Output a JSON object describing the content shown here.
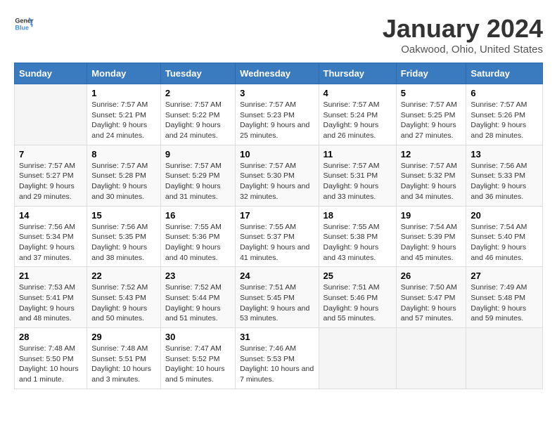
{
  "logo": {
    "line1": "General",
    "line2": "Blue"
  },
  "title": "January 2024",
  "subtitle": "Oakwood, Ohio, United States",
  "days_header": [
    "Sunday",
    "Monday",
    "Tuesday",
    "Wednesday",
    "Thursday",
    "Friday",
    "Saturday"
  ],
  "weeks": [
    [
      {
        "day": "",
        "sunrise": "",
        "sunset": "",
        "daylight": ""
      },
      {
        "day": "1",
        "sunrise": "Sunrise: 7:57 AM",
        "sunset": "Sunset: 5:21 PM",
        "daylight": "Daylight: 9 hours and 24 minutes."
      },
      {
        "day": "2",
        "sunrise": "Sunrise: 7:57 AM",
        "sunset": "Sunset: 5:22 PM",
        "daylight": "Daylight: 9 hours and 24 minutes."
      },
      {
        "day": "3",
        "sunrise": "Sunrise: 7:57 AM",
        "sunset": "Sunset: 5:23 PM",
        "daylight": "Daylight: 9 hours and 25 minutes."
      },
      {
        "day": "4",
        "sunrise": "Sunrise: 7:57 AM",
        "sunset": "Sunset: 5:24 PM",
        "daylight": "Daylight: 9 hours and 26 minutes."
      },
      {
        "day": "5",
        "sunrise": "Sunrise: 7:57 AM",
        "sunset": "Sunset: 5:25 PM",
        "daylight": "Daylight: 9 hours and 27 minutes."
      },
      {
        "day": "6",
        "sunrise": "Sunrise: 7:57 AM",
        "sunset": "Sunset: 5:26 PM",
        "daylight": "Daylight: 9 hours and 28 minutes."
      }
    ],
    [
      {
        "day": "7",
        "sunrise": "Sunrise: 7:57 AM",
        "sunset": "Sunset: 5:27 PM",
        "daylight": "Daylight: 9 hours and 29 minutes."
      },
      {
        "day": "8",
        "sunrise": "Sunrise: 7:57 AM",
        "sunset": "Sunset: 5:28 PM",
        "daylight": "Daylight: 9 hours and 30 minutes."
      },
      {
        "day": "9",
        "sunrise": "Sunrise: 7:57 AM",
        "sunset": "Sunset: 5:29 PM",
        "daylight": "Daylight: 9 hours and 31 minutes."
      },
      {
        "day": "10",
        "sunrise": "Sunrise: 7:57 AM",
        "sunset": "Sunset: 5:30 PM",
        "daylight": "Daylight: 9 hours and 32 minutes."
      },
      {
        "day": "11",
        "sunrise": "Sunrise: 7:57 AM",
        "sunset": "Sunset: 5:31 PM",
        "daylight": "Daylight: 9 hours and 33 minutes."
      },
      {
        "day": "12",
        "sunrise": "Sunrise: 7:57 AM",
        "sunset": "Sunset: 5:32 PM",
        "daylight": "Daylight: 9 hours and 34 minutes."
      },
      {
        "day": "13",
        "sunrise": "Sunrise: 7:56 AM",
        "sunset": "Sunset: 5:33 PM",
        "daylight": "Daylight: 9 hours and 36 minutes."
      }
    ],
    [
      {
        "day": "14",
        "sunrise": "Sunrise: 7:56 AM",
        "sunset": "Sunset: 5:34 PM",
        "daylight": "Daylight: 9 hours and 37 minutes."
      },
      {
        "day": "15",
        "sunrise": "Sunrise: 7:56 AM",
        "sunset": "Sunset: 5:35 PM",
        "daylight": "Daylight: 9 hours and 38 minutes."
      },
      {
        "day": "16",
        "sunrise": "Sunrise: 7:55 AM",
        "sunset": "Sunset: 5:36 PM",
        "daylight": "Daylight: 9 hours and 40 minutes."
      },
      {
        "day": "17",
        "sunrise": "Sunrise: 7:55 AM",
        "sunset": "Sunset: 5:37 PM",
        "daylight": "Daylight: 9 hours and 41 minutes."
      },
      {
        "day": "18",
        "sunrise": "Sunrise: 7:55 AM",
        "sunset": "Sunset: 5:38 PM",
        "daylight": "Daylight: 9 hours and 43 minutes."
      },
      {
        "day": "19",
        "sunrise": "Sunrise: 7:54 AM",
        "sunset": "Sunset: 5:39 PM",
        "daylight": "Daylight: 9 hours and 45 minutes."
      },
      {
        "day": "20",
        "sunrise": "Sunrise: 7:54 AM",
        "sunset": "Sunset: 5:40 PM",
        "daylight": "Daylight: 9 hours and 46 minutes."
      }
    ],
    [
      {
        "day": "21",
        "sunrise": "Sunrise: 7:53 AM",
        "sunset": "Sunset: 5:41 PM",
        "daylight": "Daylight: 9 hours and 48 minutes."
      },
      {
        "day": "22",
        "sunrise": "Sunrise: 7:52 AM",
        "sunset": "Sunset: 5:43 PM",
        "daylight": "Daylight: 9 hours and 50 minutes."
      },
      {
        "day": "23",
        "sunrise": "Sunrise: 7:52 AM",
        "sunset": "Sunset: 5:44 PM",
        "daylight": "Daylight: 9 hours and 51 minutes."
      },
      {
        "day": "24",
        "sunrise": "Sunrise: 7:51 AM",
        "sunset": "Sunset: 5:45 PM",
        "daylight": "Daylight: 9 hours and 53 minutes."
      },
      {
        "day": "25",
        "sunrise": "Sunrise: 7:51 AM",
        "sunset": "Sunset: 5:46 PM",
        "daylight": "Daylight: 9 hours and 55 minutes."
      },
      {
        "day": "26",
        "sunrise": "Sunrise: 7:50 AM",
        "sunset": "Sunset: 5:47 PM",
        "daylight": "Daylight: 9 hours and 57 minutes."
      },
      {
        "day": "27",
        "sunrise": "Sunrise: 7:49 AM",
        "sunset": "Sunset: 5:48 PM",
        "daylight": "Daylight: 9 hours and 59 minutes."
      }
    ],
    [
      {
        "day": "28",
        "sunrise": "Sunrise: 7:48 AM",
        "sunset": "Sunset: 5:50 PM",
        "daylight": "Daylight: 10 hours and 1 minute."
      },
      {
        "day": "29",
        "sunrise": "Sunrise: 7:48 AM",
        "sunset": "Sunset: 5:51 PM",
        "daylight": "Daylight: 10 hours and 3 minutes."
      },
      {
        "day": "30",
        "sunrise": "Sunrise: 7:47 AM",
        "sunset": "Sunset: 5:52 PM",
        "daylight": "Daylight: 10 hours and 5 minutes."
      },
      {
        "day": "31",
        "sunrise": "Sunrise: 7:46 AM",
        "sunset": "Sunset: 5:53 PM",
        "daylight": "Daylight: 10 hours and 7 minutes."
      },
      {
        "day": "",
        "sunrise": "",
        "sunset": "",
        "daylight": ""
      },
      {
        "day": "",
        "sunrise": "",
        "sunset": "",
        "daylight": ""
      },
      {
        "day": "",
        "sunrise": "",
        "sunset": "",
        "daylight": ""
      }
    ]
  ]
}
